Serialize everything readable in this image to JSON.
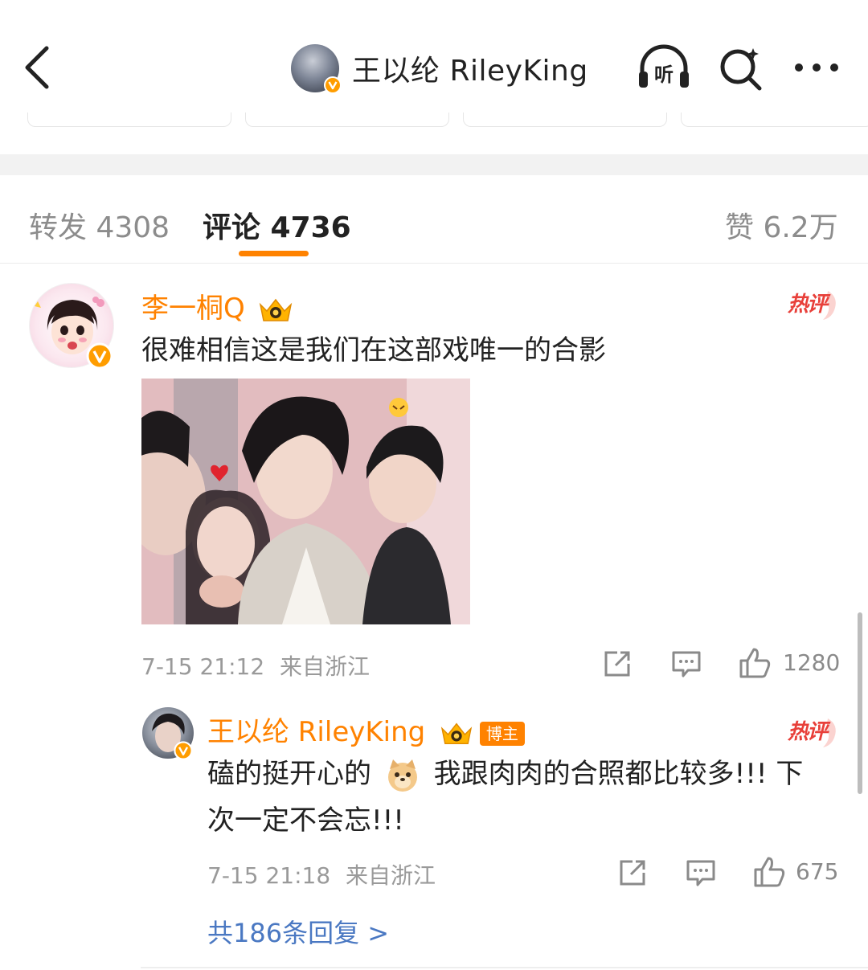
{
  "header": {
    "title": "王以纶 RileyKing",
    "listen_label": "听"
  },
  "tabs": {
    "repost": "转发 4308",
    "comments": "评论 4736",
    "likes": "赞 6.2万"
  },
  "comment": {
    "username": "李一桐Q",
    "hot_label": "热评",
    "text": "很难相信这是我们在这部戏唯一的合影",
    "time": "7-15 21:12",
    "location": "来自浙江",
    "like_count": "1280"
  },
  "reply": {
    "username": "王以纶 RileyKing",
    "owner_badge": "博主",
    "hot_label": "热评",
    "text_line1_a": "磕的挺开心的",
    "text_line1_b": "我跟肉肉的合照都比较多!!! 下",
    "text_line2": "次一定不会忘!!!",
    "time": "7-15 21:18",
    "location": "来自浙江",
    "like_count": "675"
  },
  "more_replies": "共186条回复 >",
  "colors": {
    "accent": "#ff8200",
    "link": "#4a78c2",
    "hot": "#e8403a"
  }
}
